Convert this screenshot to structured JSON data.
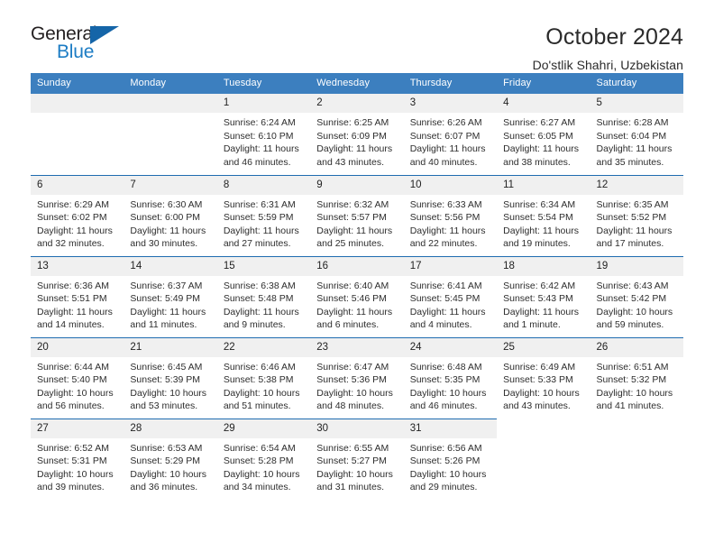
{
  "logo": {
    "word_top": "General",
    "word_bottom": "Blue",
    "triangle_color": "#1565a8",
    "blue_text_color": "#1c7cc4"
  },
  "header": {
    "title": "October 2024",
    "subtitle": "Do'stlik Shahri, Uzbekistan"
  },
  "theme": {
    "header_row_bg": "#3c7fbf",
    "row_divider": "#1f6cb0",
    "daynum_bg": "#f0f0f0"
  },
  "weekday_headers": [
    "Sunday",
    "Monday",
    "Tuesday",
    "Wednesday",
    "Thursday",
    "Friday",
    "Saturday"
  ],
  "labels": {
    "sunrise_prefix": "Sunrise:",
    "sunset_prefix": "Sunset:",
    "daylight_prefix": "Daylight:"
  },
  "weeks": [
    [
      {
        "day": "",
        "blank": true
      },
      {
        "day": "",
        "blank": true
      },
      {
        "day": "1",
        "sunrise": "Sunrise: 6:24 AM",
        "sunset": "Sunset: 6:10 PM",
        "daylight_line1": "Daylight: 11 hours",
        "daylight_line2": "and 46 minutes."
      },
      {
        "day": "2",
        "sunrise": "Sunrise: 6:25 AM",
        "sunset": "Sunset: 6:09 PM",
        "daylight_line1": "Daylight: 11 hours",
        "daylight_line2": "and 43 minutes."
      },
      {
        "day": "3",
        "sunrise": "Sunrise: 6:26 AM",
        "sunset": "Sunset: 6:07 PM",
        "daylight_line1": "Daylight: 11 hours",
        "daylight_line2": "and 40 minutes."
      },
      {
        "day": "4",
        "sunrise": "Sunrise: 6:27 AM",
        "sunset": "Sunset: 6:05 PM",
        "daylight_line1": "Daylight: 11 hours",
        "daylight_line2": "and 38 minutes."
      },
      {
        "day": "5",
        "sunrise": "Sunrise: 6:28 AM",
        "sunset": "Sunset: 6:04 PM",
        "daylight_line1": "Daylight: 11 hours",
        "daylight_line2": "and 35 minutes."
      }
    ],
    [
      {
        "day": "6",
        "sunrise": "Sunrise: 6:29 AM",
        "sunset": "Sunset: 6:02 PM",
        "daylight_line1": "Daylight: 11 hours",
        "daylight_line2": "and 32 minutes."
      },
      {
        "day": "7",
        "sunrise": "Sunrise: 6:30 AM",
        "sunset": "Sunset: 6:00 PM",
        "daylight_line1": "Daylight: 11 hours",
        "daylight_line2": "and 30 minutes."
      },
      {
        "day": "8",
        "sunrise": "Sunrise: 6:31 AM",
        "sunset": "Sunset: 5:59 PM",
        "daylight_line1": "Daylight: 11 hours",
        "daylight_line2": "and 27 minutes."
      },
      {
        "day": "9",
        "sunrise": "Sunrise: 6:32 AM",
        "sunset": "Sunset: 5:57 PM",
        "daylight_line1": "Daylight: 11 hours",
        "daylight_line2": "and 25 minutes."
      },
      {
        "day": "10",
        "sunrise": "Sunrise: 6:33 AM",
        "sunset": "Sunset: 5:56 PM",
        "daylight_line1": "Daylight: 11 hours",
        "daylight_line2": "and 22 minutes."
      },
      {
        "day": "11",
        "sunrise": "Sunrise: 6:34 AM",
        "sunset": "Sunset: 5:54 PM",
        "daylight_line1": "Daylight: 11 hours",
        "daylight_line2": "and 19 minutes."
      },
      {
        "day": "12",
        "sunrise": "Sunrise: 6:35 AM",
        "sunset": "Sunset: 5:52 PM",
        "daylight_line1": "Daylight: 11 hours",
        "daylight_line2": "and 17 minutes."
      }
    ],
    [
      {
        "day": "13",
        "sunrise": "Sunrise: 6:36 AM",
        "sunset": "Sunset: 5:51 PM",
        "daylight_line1": "Daylight: 11 hours",
        "daylight_line2": "and 14 minutes."
      },
      {
        "day": "14",
        "sunrise": "Sunrise: 6:37 AM",
        "sunset": "Sunset: 5:49 PM",
        "daylight_line1": "Daylight: 11 hours",
        "daylight_line2": "and 11 minutes."
      },
      {
        "day": "15",
        "sunrise": "Sunrise: 6:38 AM",
        "sunset": "Sunset: 5:48 PM",
        "daylight_line1": "Daylight: 11 hours",
        "daylight_line2": "and 9 minutes."
      },
      {
        "day": "16",
        "sunrise": "Sunrise: 6:40 AM",
        "sunset": "Sunset: 5:46 PM",
        "daylight_line1": "Daylight: 11 hours",
        "daylight_line2": "and 6 minutes."
      },
      {
        "day": "17",
        "sunrise": "Sunrise: 6:41 AM",
        "sunset": "Sunset: 5:45 PM",
        "daylight_line1": "Daylight: 11 hours",
        "daylight_line2": "and 4 minutes."
      },
      {
        "day": "18",
        "sunrise": "Sunrise: 6:42 AM",
        "sunset": "Sunset: 5:43 PM",
        "daylight_line1": "Daylight: 11 hours",
        "daylight_line2": "and 1 minute."
      },
      {
        "day": "19",
        "sunrise": "Sunrise: 6:43 AM",
        "sunset": "Sunset: 5:42 PM",
        "daylight_line1": "Daylight: 10 hours",
        "daylight_line2": "and 59 minutes."
      }
    ],
    [
      {
        "day": "20",
        "sunrise": "Sunrise: 6:44 AM",
        "sunset": "Sunset: 5:40 PM",
        "daylight_line1": "Daylight: 10 hours",
        "daylight_line2": "and 56 minutes."
      },
      {
        "day": "21",
        "sunrise": "Sunrise: 6:45 AM",
        "sunset": "Sunset: 5:39 PM",
        "daylight_line1": "Daylight: 10 hours",
        "daylight_line2": "and 53 minutes."
      },
      {
        "day": "22",
        "sunrise": "Sunrise: 6:46 AM",
        "sunset": "Sunset: 5:38 PM",
        "daylight_line1": "Daylight: 10 hours",
        "daylight_line2": "and 51 minutes."
      },
      {
        "day": "23",
        "sunrise": "Sunrise: 6:47 AM",
        "sunset": "Sunset: 5:36 PM",
        "daylight_line1": "Daylight: 10 hours",
        "daylight_line2": "and 48 minutes."
      },
      {
        "day": "24",
        "sunrise": "Sunrise: 6:48 AM",
        "sunset": "Sunset: 5:35 PM",
        "daylight_line1": "Daylight: 10 hours",
        "daylight_line2": "and 46 minutes."
      },
      {
        "day": "25",
        "sunrise": "Sunrise: 6:49 AM",
        "sunset": "Sunset: 5:33 PM",
        "daylight_line1": "Daylight: 10 hours",
        "daylight_line2": "and 43 minutes."
      },
      {
        "day": "26",
        "sunrise": "Sunrise: 6:51 AM",
        "sunset": "Sunset: 5:32 PM",
        "daylight_line1": "Daylight: 10 hours",
        "daylight_line2": "and 41 minutes."
      }
    ],
    [
      {
        "day": "27",
        "sunrise": "Sunrise: 6:52 AM",
        "sunset": "Sunset: 5:31 PM",
        "daylight_line1": "Daylight: 10 hours",
        "daylight_line2": "and 39 minutes."
      },
      {
        "day": "28",
        "sunrise": "Sunrise: 6:53 AM",
        "sunset": "Sunset: 5:29 PM",
        "daylight_line1": "Daylight: 10 hours",
        "daylight_line2": "and 36 minutes."
      },
      {
        "day": "29",
        "sunrise": "Sunrise: 6:54 AM",
        "sunset": "Sunset: 5:28 PM",
        "daylight_line1": "Daylight: 10 hours",
        "daylight_line2": "and 34 minutes."
      },
      {
        "day": "30",
        "sunrise": "Sunrise: 6:55 AM",
        "sunset": "Sunset: 5:27 PM",
        "daylight_line1": "Daylight: 10 hours",
        "daylight_line2": "and 31 minutes."
      },
      {
        "day": "31",
        "sunrise": "Sunrise: 6:56 AM",
        "sunset": "Sunset: 5:26 PM",
        "daylight_line1": "Daylight: 10 hours",
        "daylight_line2": "and 29 minutes."
      },
      {
        "day": "",
        "blank": true,
        "trailing": true
      },
      {
        "day": "",
        "blank": true,
        "trailing": true
      }
    ]
  ]
}
